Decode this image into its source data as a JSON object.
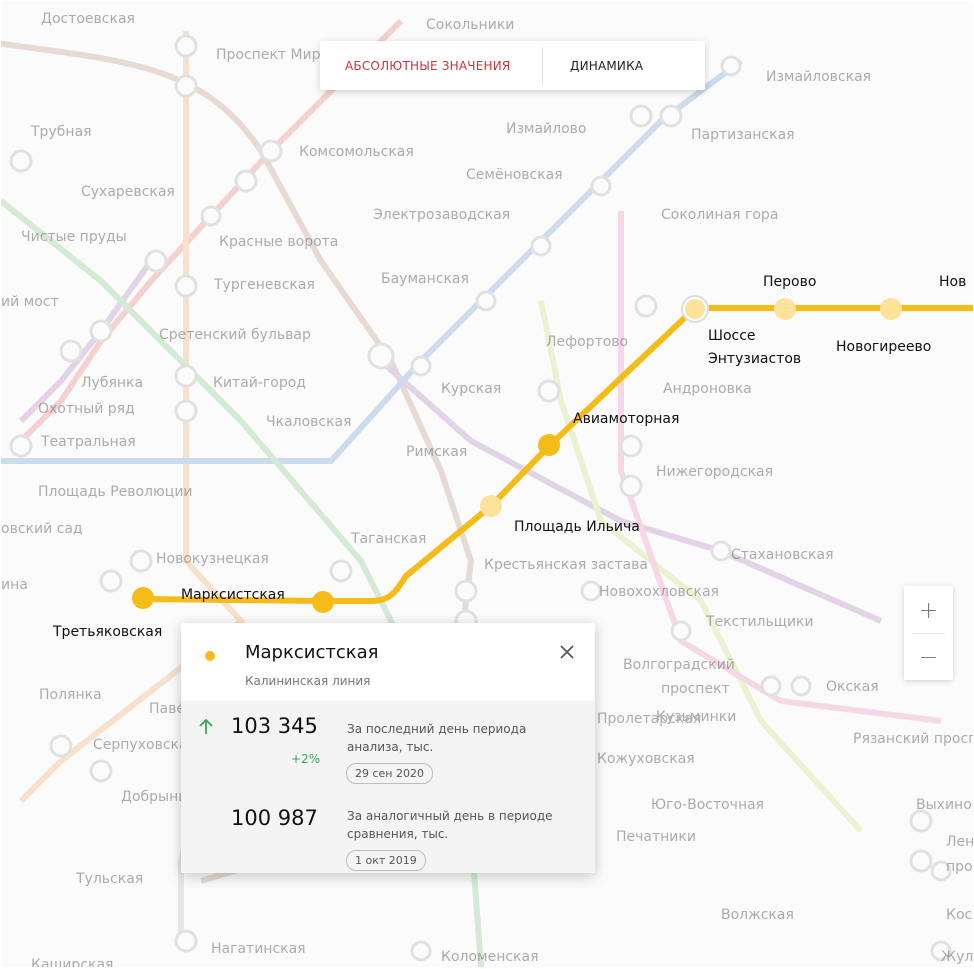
{
  "tabs": {
    "absolute_label": "АБСОЛЮТНЫЕ ЗНАЧЕНИЯ",
    "dynamics_label": "ДИНАМИКА"
  },
  "zoom": {
    "in_label": "+",
    "out_label": "−"
  },
  "map": {
    "colors": {
      "highlight_line": "#f5bb16",
      "highlight_station_light": "#fde39a"
    },
    "faded_stations": [
      "Достоевская",
      "Проспект Мира",
      "Сокольники",
      "Измайловская",
      "Трубная",
      "Измайлово",
      "Партизанская",
      "Комсомольская",
      "Сухаревская",
      "Семёновская",
      "Электрозаводская",
      "Соколиная гора",
      "Чистые пруды",
      "Красные ворота",
      "Тургеневская",
      "Бауманская",
      "ий мост",
      "Сретенский бульвар",
      "Лефортово",
      "Лубянка",
      "Китай-город",
      "Курская",
      "Андроновка",
      "Охотный ряд",
      "Чкаловская",
      "Театральная",
      "Римская",
      "Нижегородская",
      "Площадь Революции",
      "овский сад",
      "Новокузнецкая",
      "Таганская",
      "Стахановская",
      "Крестьянская застава",
      "Новохохловская",
      "ина",
      "Текстильщики",
      "Полянка",
      "Павелецкая",
      "Волгоградский",
      "проспект",
      "Окская",
      "Кузьминки",
      "Серпуховская",
      "Рязанский проспект",
      "Пролетарская",
      "Добрынинская",
      "Кожуховская",
      "Юго-Восточная",
      "Выхино",
      "Печатники",
      "Тульская",
      "Ленинский",
      "проспект",
      "Волжская",
      "Нагатинская",
      "Коломенская",
      "Косино",
      "Жулебино",
      "Каширская"
    ],
    "highlight_stations": [
      "Третьяковская",
      "Марксистская",
      "Площадь Ильича",
      "Авиамоторная",
      "Шоссе",
      "Энтузиастов",
      "Перово",
      "Новогиреево",
      "Нов"
    ]
  },
  "card": {
    "title": "Марксистская",
    "line": "Калининская линия",
    "current": {
      "value": "103 345",
      "change": "+2%",
      "description_1": "За последний день периода",
      "description_2": "анализа, тыс.",
      "date": "29 сен 2020"
    },
    "comparison": {
      "value": "100 987",
      "description_1": "За аналогичный день в периоде",
      "description_2": "сравнения, тыс.",
      "date": "1 окт 2019"
    }
  }
}
